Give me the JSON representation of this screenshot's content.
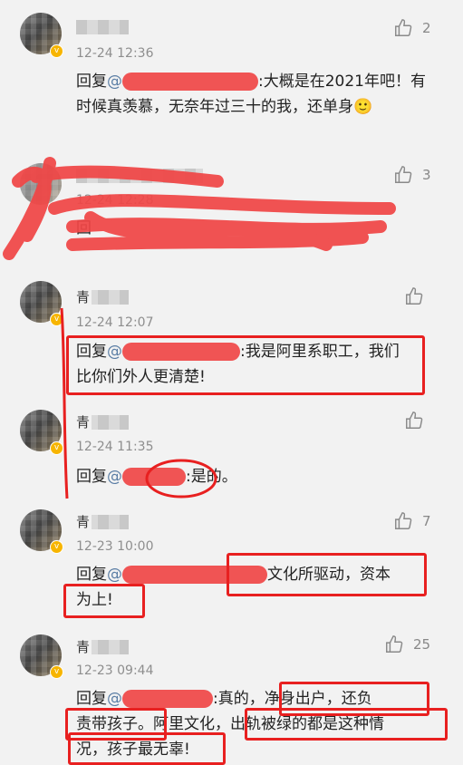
{
  "comments": [
    {
      "time": "12-24 12:36",
      "like_count": "2",
      "reply_prefix": "回复",
      "mention": "@",
      "text": ":大概是在2021年吧！有时候真羡慕，无奈年过三十的我，还单身",
      "emoji": "🙂"
    },
    {
      "time": "12-24 12:28",
      "like_count": "3",
      "reply_prefix": "回",
      "text": ""
    },
    {
      "name_char": "青",
      "time": "12-24 12:07",
      "reply_prefix": "回复",
      "mention": "@",
      "text": ":我是阿里系职工，我们比你们外人更清楚!"
    },
    {
      "name_char": "青",
      "time": "12-24 11:35",
      "reply_prefix": "回复",
      "mention": "@",
      "text": ":是的。"
    },
    {
      "name_char": "青",
      "time": "12-23 10:00",
      "like_count": "7",
      "reply_prefix": "回复",
      "mention": "@",
      "text_line1_end": "文化所驱动，资本",
      "text_line2": "为上!"
    },
    {
      "name_char": "青",
      "time": "12-23 09:44",
      "like_count": "25",
      "reply_prefix": "回复",
      "mention": "@",
      "text_line1_end": ":真的，净身出户，还负",
      "text_line2": "责带孩子。阿里文化，出轨被绿的都是这种情",
      "text_line3": "况，孩子最无辜!"
    }
  ],
  "colors": {
    "accent_red": "#e82020",
    "mention_blue": "#5b7ea5",
    "badge_gold": "#f7b500"
  },
  "icons": {
    "like": "thumbs-up-icon",
    "verified": "v-badge-icon"
  }
}
